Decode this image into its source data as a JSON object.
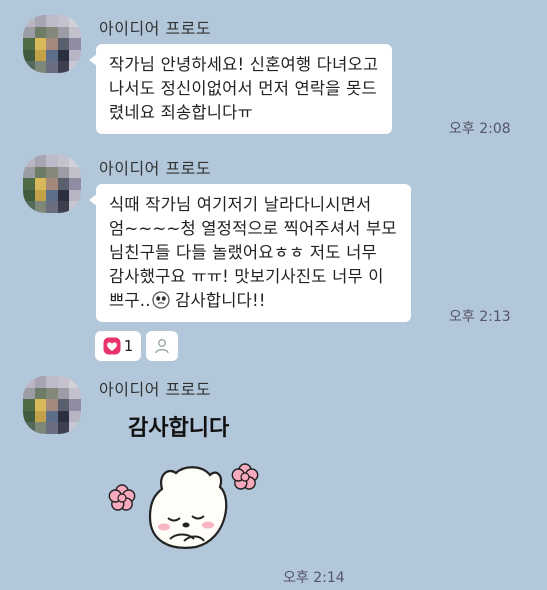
{
  "messages": [
    {
      "sender": "아이디어 프로도",
      "lines": [
        "작가님 안녕하세요! 신혼여행 다녀오고",
        "나서도 정신이없어서 먼저 연락을 못드",
        "렸네요 죄송합니다ㅠ"
      ],
      "time": "오후 2:08"
    },
    {
      "sender": "아이디어 프로도",
      "lines": [
        "식때 작가님 여기저기 날라다니시면서",
        "엄~~~~청 열정적으로 찍어주셔서 부모",
        "님친구들 다들 놀랬어요ㅎㅎ 저도 너무",
        "감사했구요 ㅠㅠ! 맛보기사진도 너무 이",
        "쁘구..",
        " 감사합니다!!"
      ],
      "time": "오후 2:13",
      "reaction": {
        "icon": "heart-icon",
        "count": "1"
      }
    },
    {
      "sender": "아이디어 프로도",
      "sticker_text": "감사합니다",
      "time": "오후 2:14"
    }
  ],
  "colors": {
    "background": "#b2c7da",
    "bubble": "#ffffff",
    "heart": "#e8336d"
  }
}
